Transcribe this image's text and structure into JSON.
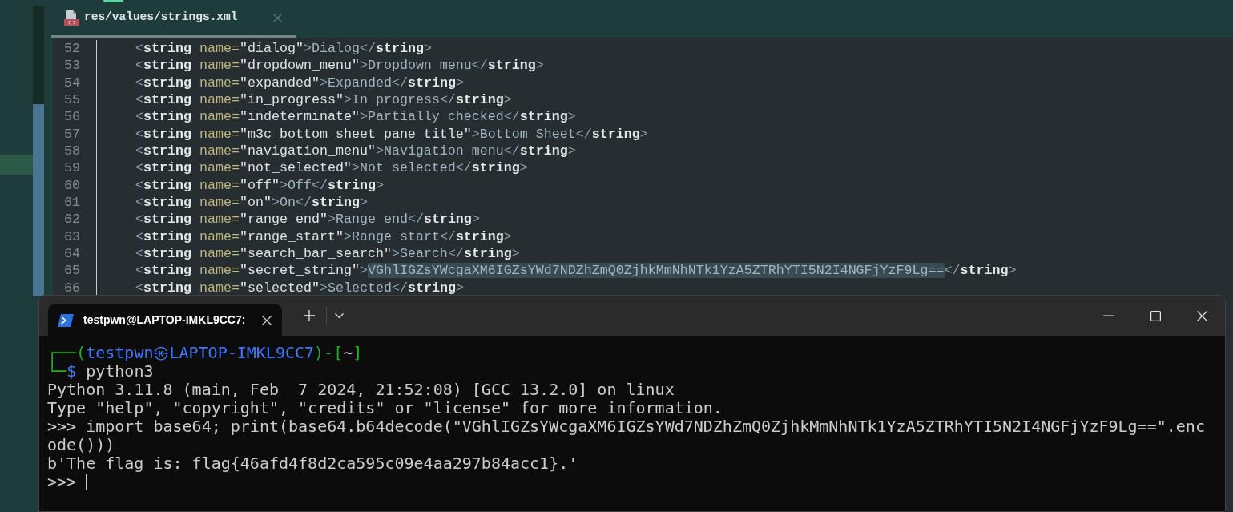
{
  "editor": {
    "tabs": [
      {
        "title": "res/values/strings.xml",
        "selected": true
      }
    ],
    "lines": [
      {
        "number": "52",
        "tokens": [
          {
            "kind": "bracket",
            "text": "<"
          },
          {
            "kind": "tag",
            "text": "string"
          },
          {
            "kind": "attribute",
            "text": " name="
          },
          {
            "kind": "value",
            "text": "\"dialog\""
          },
          {
            "kind": "bracket",
            "text": ">"
          },
          {
            "kind": "content",
            "text": "Dialog",
            "selected": false
          },
          {
            "kind": "bracket",
            "text": "</"
          },
          {
            "kind": "tag",
            "text": "string"
          },
          {
            "kind": "bracket",
            "text": ">"
          }
        ]
      },
      {
        "number": "53",
        "tokens": [
          {
            "kind": "bracket",
            "text": "<"
          },
          {
            "kind": "tag",
            "text": "string"
          },
          {
            "kind": "attribute",
            "text": " name="
          },
          {
            "kind": "value",
            "text": "\"dropdown_menu\""
          },
          {
            "kind": "bracket",
            "text": ">"
          },
          {
            "kind": "content",
            "text": "Dropdown menu",
            "selected": false
          },
          {
            "kind": "bracket",
            "text": "</"
          },
          {
            "kind": "tag",
            "text": "string"
          },
          {
            "kind": "bracket",
            "text": ">"
          }
        ]
      },
      {
        "number": "54",
        "tokens": [
          {
            "kind": "bracket",
            "text": "<"
          },
          {
            "kind": "tag",
            "text": "string"
          },
          {
            "kind": "attribute",
            "text": " name="
          },
          {
            "kind": "value",
            "text": "\"expanded\""
          },
          {
            "kind": "bracket",
            "text": ">"
          },
          {
            "kind": "content",
            "text": "Expanded",
            "selected": false
          },
          {
            "kind": "bracket",
            "text": "</"
          },
          {
            "kind": "tag",
            "text": "string"
          },
          {
            "kind": "bracket",
            "text": ">"
          }
        ]
      },
      {
        "number": "55",
        "tokens": [
          {
            "kind": "bracket",
            "text": "<"
          },
          {
            "kind": "tag",
            "text": "string"
          },
          {
            "kind": "attribute",
            "text": " name="
          },
          {
            "kind": "value",
            "text": "\"in_progress\""
          },
          {
            "kind": "bracket",
            "text": ">"
          },
          {
            "kind": "content",
            "text": "In progress",
            "selected": false
          },
          {
            "kind": "bracket",
            "text": "</"
          },
          {
            "kind": "tag",
            "text": "string"
          },
          {
            "kind": "bracket",
            "text": ">"
          }
        ]
      },
      {
        "number": "56",
        "tokens": [
          {
            "kind": "bracket",
            "text": "<"
          },
          {
            "kind": "tag",
            "text": "string"
          },
          {
            "kind": "attribute",
            "text": " name="
          },
          {
            "kind": "value",
            "text": "\"indeterminate\""
          },
          {
            "kind": "bracket",
            "text": ">"
          },
          {
            "kind": "content",
            "text": "Partially checked",
            "selected": false
          },
          {
            "kind": "bracket",
            "text": "</"
          },
          {
            "kind": "tag",
            "text": "string"
          },
          {
            "kind": "bracket",
            "text": ">"
          }
        ]
      },
      {
        "number": "57",
        "tokens": [
          {
            "kind": "bracket",
            "text": "<"
          },
          {
            "kind": "tag",
            "text": "string"
          },
          {
            "kind": "attribute",
            "text": " name="
          },
          {
            "kind": "value",
            "text": "\"m3c_bottom_sheet_pane_title\""
          },
          {
            "kind": "bracket",
            "text": ">"
          },
          {
            "kind": "content",
            "text": "Bottom Sheet",
            "selected": false
          },
          {
            "kind": "bracket",
            "text": "</"
          },
          {
            "kind": "tag",
            "text": "string"
          },
          {
            "kind": "bracket",
            "text": ">"
          }
        ]
      },
      {
        "number": "58",
        "tokens": [
          {
            "kind": "bracket",
            "text": "<"
          },
          {
            "kind": "tag",
            "text": "string"
          },
          {
            "kind": "attribute",
            "text": " name="
          },
          {
            "kind": "value",
            "text": "\"navigation_menu\""
          },
          {
            "kind": "bracket",
            "text": ">"
          },
          {
            "kind": "content",
            "text": "Navigation menu",
            "selected": false
          },
          {
            "kind": "bracket",
            "text": "</"
          },
          {
            "kind": "tag",
            "text": "string"
          },
          {
            "kind": "bracket",
            "text": ">"
          }
        ]
      },
      {
        "number": "59",
        "tokens": [
          {
            "kind": "bracket",
            "text": "<"
          },
          {
            "kind": "tag",
            "text": "string"
          },
          {
            "kind": "attribute",
            "text": " name="
          },
          {
            "kind": "value",
            "text": "\"not_selected\""
          },
          {
            "kind": "bracket",
            "text": ">"
          },
          {
            "kind": "content",
            "text": "Not selected",
            "selected": false
          },
          {
            "kind": "bracket",
            "text": "</"
          },
          {
            "kind": "tag",
            "text": "string"
          },
          {
            "kind": "bracket",
            "text": ">"
          }
        ]
      },
      {
        "number": "60",
        "tokens": [
          {
            "kind": "bracket",
            "text": "<"
          },
          {
            "kind": "tag",
            "text": "string"
          },
          {
            "kind": "attribute",
            "text": " name="
          },
          {
            "kind": "value",
            "text": "\"off\""
          },
          {
            "kind": "bracket",
            "text": ">"
          },
          {
            "kind": "content",
            "text": "Off",
            "selected": false
          },
          {
            "kind": "bracket",
            "text": "</"
          },
          {
            "kind": "tag",
            "text": "string"
          },
          {
            "kind": "bracket",
            "text": ">"
          }
        ]
      },
      {
        "number": "61",
        "tokens": [
          {
            "kind": "bracket",
            "text": "<"
          },
          {
            "kind": "tag",
            "text": "string"
          },
          {
            "kind": "attribute",
            "text": " name="
          },
          {
            "kind": "value",
            "text": "\"on\""
          },
          {
            "kind": "bracket",
            "text": ">"
          },
          {
            "kind": "content",
            "text": "On",
            "selected": false
          },
          {
            "kind": "bracket",
            "text": "</"
          },
          {
            "kind": "tag",
            "text": "string"
          },
          {
            "kind": "bracket",
            "text": ">"
          }
        ]
      },
      {
        "number": "62",
        "tokens": [
          {
            "kind": "bracket",
            "text": "<"
          },
          {
            "kind": "tag",
            "text": "string"
          },
          {
            "kind": "attribute",
            "text": " name="
          },
          {
            "kind": "value",
            "text": "\"range_end\""
          },
          {
            "kind": "bracket",
            "text": ">"
          },
          {
            "kind": "content",
            "text": "Range end",
            "selected": false
          },
          {
            "kind": "bracket",
            "text": "</"
          },
          {
            "kind": "tag",
            "text": "string"
          },
          {
            "kind": "bracket",
            "text": ">"
          }
        ]
      },
      {
        "number": "63",
        "tokens": [
          {
            "kind": "bracket",
            "text": "<"
          },
          {
            "kind": "tag",
            "text": "string"
          },
          {
            "kind": "attribute",
            "text": " name="
          },
          {
            "kind": "value",
            "text": "\"range_start\""
          },
          {
            "kind": "bracket",
            "text": ">"
          },
          {
            "kind": "content",
            "text": "Range start",
            "selected": false
          },
          {
            "kind": "bracket",
            "text": "</"
          },
          {
            "kind": "tag",
            "text": "string"
          },
          {
            "kind": "bracket",
            "text": ">"
          }
        ]
      },
      {
        "number": "64",
        "tokens": [
          {
            "kind": "bracket",
            "text": "<"
          },
          {
            "kind": "tag",
            "text": "string"
          },
          {
            "kind": "attribute",
            "text": " name="
          },
          {
            "kind": "value",
            "text": "\"search_bar_search\""
          },
          {
            "kind": "bracket",
            "text": ">"
          },
          {
            "kind": "content",
            "text": "Search",
            "selected": false
          },
          {
            "kind": "bracket",
            "text": "</"
          },
          {
            "kind": "tag",
            "text": "string"
          },
          {
            "kind": "bracket",
            "text": ">"
          }
        ]
      },
      {
        "number": "65",
        "tokens": [
          {
            "kind": "bracket",
            "text": "<"
          },
          {
            "kind": "tag",
            "text": "string"
          },
          {
            "kind": "attribute",
            "text": " name="
          },
          {
            "kind": "value",
            "text": "\"secret_string\""
          },
          {
            "kind": "bracket",
            "text": ">"
          },
          {
            "kind": "content",
            "text": "VGhlIGZsYWcgaXM6IGZsYWd7NDZhZmQ0ZjhkMmNhNTk1YzA5ZTRhYTI5N2I4NGFjYzF9Lg==",
            "selected": true
          },
          {
            "kind": "bracket",
            "text": "</"
          },
          {
            "kind": "tag",
            "text": "string"
          },
          {
            "kind": "bracket",
            "text": ">"
          }
        ]
      },
      {
        "number": "66",
        "tokens": [
          {
            "kind": "bracket",
            "text": "<"
          },
          {
            "kind": "tag",
            "text": "string"
          },
          {
            "kind": "attribute",
            "text": " name="
          },
          {
            "kind": "value",
            "text": "\"selected\""
          },
          {
            "kind": "bracket",
            "text": ">"
          },
          {
            "kind": "content",
            "text": "Selected",
            "selected": false
          },
          {
            "kind": "bracket",
            "text": "</"
          },
          {
            "kind": "tag",
            "text": "string"
          },
          {
            "kind": "bracket",
            "text": ">"
          }
        ]
      }
    ]
  },
  "terminal": {
    "tabs": [
      {
        "title": "testpwn@LAPTOP-IMKL9CC7:",
        "selected": true
      }
    ],
    "lines": [
      {
        "segments": [
          {
            "kind": "frame",
            "text": "┌──("
          },
          {
            "kind": "host",
            "text": "testpwn㉿LAPTOP-IMKL9CC7"
          },
          {
            "kind": "frame",
            "text": ")-["
          },
          {
            "kind": "path",
            "text": "~"
          },
          {
            "kind": "frame",
            "text": "]"
          }
        ]
      },
      {
        "segments": [
          {
            "kind": "frame",
            "text": "└─"
          },
          {
            "kind": "host",
            "text": "$"
          },
          {
            "kind": "plain",
            "text": " python3"
          }
        ]
      },
      {
        "segments": [
          {
            "kind": "plain",
            "text": "Python 3.11.8 (main, Feb  7 2024, 21:52:08) [GCC 13.2.0] on linux"
          }
        ]
      },
      {
        "segments": [
          {
            "kind": "plain",
            "text": "Type \"help\", \"copyright\", \"credits\" or \"license\" for more information."
          }
        ]
      },
      {
        "segments": [
          {
            "kind": "plain",
            "text": ">>> import base64; print(base64.b64decode(\"VGhlIGZsYWcgaXM6IGZsYWd7NDZhZmQ0ZjhkMmNhNTk1YzA5ZTRhYTI5N2I4NGFjYzF9Lg==\".enc"
          }
        ]
      },
      {
        "segments": [
          {
            "kind": "plain",
            "text": "ode()))"
          }
        ]
      },
      {
        "segments": [
          {
            "kind": "plain",
            "text": "b'The flag is: flag{46afd4f8d2ca595c09e4aa297b84acc1}.'"
          }
        ]
      },
      {
        "segments": [
          {
            "kind": "plain",
            "text": ">>>"
          }
        ]
      }
    ],
    "cursor": true
  }
}
